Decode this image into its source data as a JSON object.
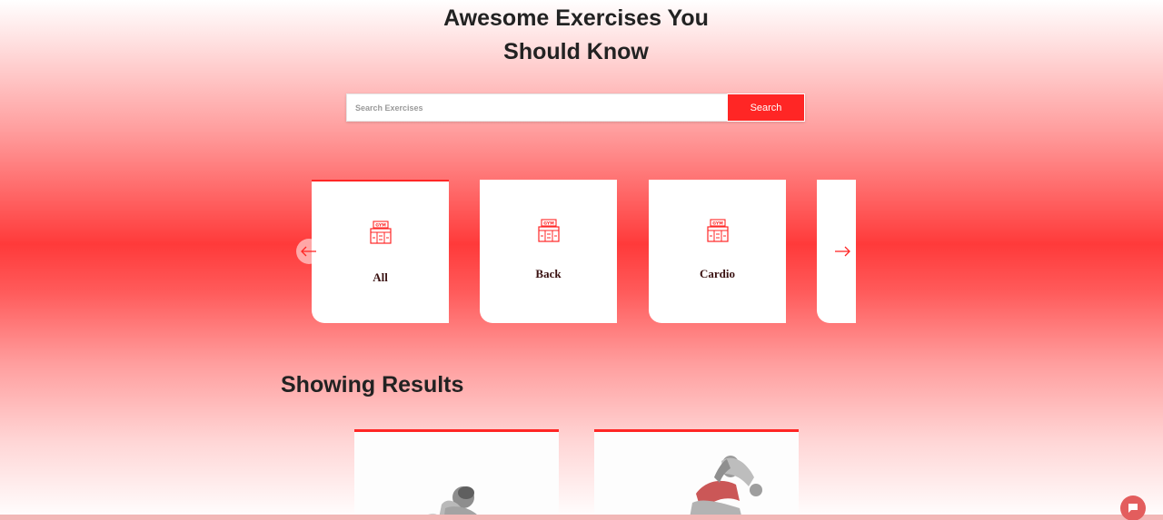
{
  "hero": {
    "title_line1": "Awesome Exercises You",
    "title_line2": "Should Know"
  },
  "search": {
    "placeholder": "Search Exercises",
    "value": "",
    "button_label": "Search"
  },
  "body_parts": {
    "items": [
      {
        "label": "All",
        "icon": "gym-icon",
        "selected": true
      },
      {
        "label": "Back",
        "icon": "gym-icon",
        "selected": false
      },
      {
        "label": "Cardio",
        "icon": "gym-icon",
        "selected": false
      },
      {
        "label": "",
        "icon": "gym-icon",
        "selected": false
      }
    ],
    "prev_icon": "arrow-left-icon",
    "next_icon": "arrow-right-icon"
  },
  "results": {
    "heading": "Showing Results"
  },
  "exercises": [
    {
      "image": "exercise-image"
    },
    {
      "image": "exercise-image"
    }
  ],
  "colors": {
    "accent": "#ff2625",
    "card_bg": "#ffffff",
    "text_dark": "#222222",
    "label_text": "#3a1212"
  },
  "chat": {
    "icon": "chat-icon"
  }
}
